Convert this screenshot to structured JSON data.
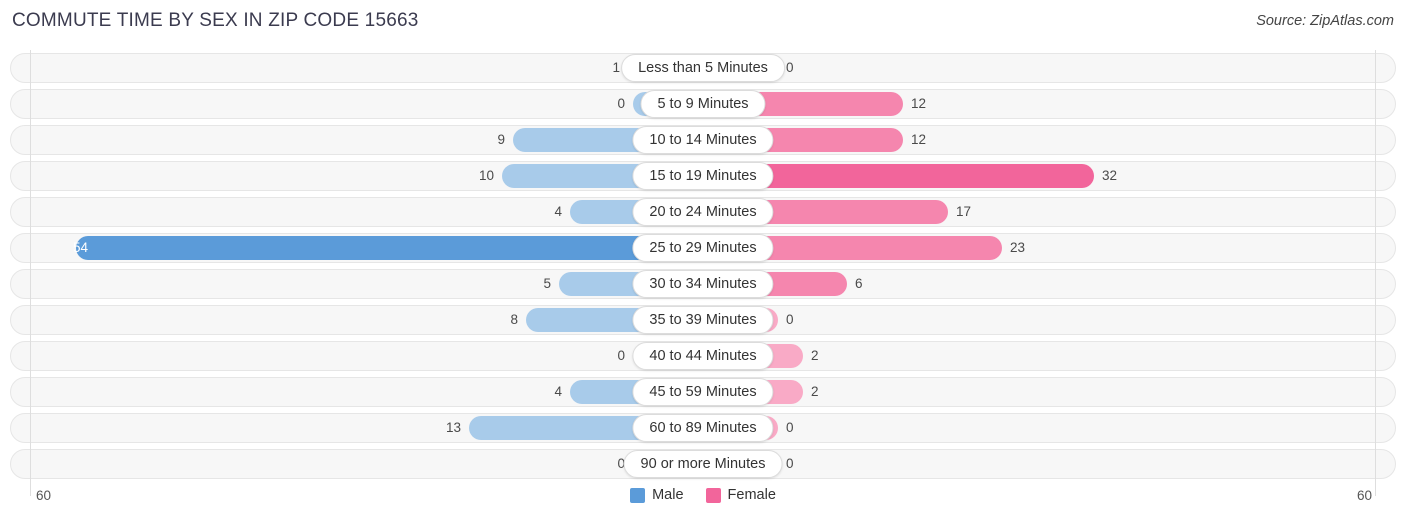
{
  "header": {
    "title": "COMMUTE TIME BY SEX IN ZIP CODE 15663",
    "source": "Source: ZipAtlas.com"
  },
  "axis": {
    "left_label": "60",
    "right_label": "60",
    "max": 60
  },
  "legend": {
    "items": [
      {
        "label": "Male",
        "color": "#5b9bd9"
      },
      {
        "label": "Female",
        "color": "#f2659b"
      }
    ]
  },
  "colors": {
    "male_light": "#a8cbea",
    "male_dark": "#5b9bd9",
    "female_light": "#f9aac6",
    "female_mid": "#f586ae",
    "female_dark": "#f2659b",
    "track": "#f7f7f7"
  },
  "chart_data": {
    "type": "bar",
    "title": "COMMUTE TIME BY SEX IN ZIP CODE 15663",
    "xlabel": "",
    "ylabel": "",
    "orientation": "horizontal-diverging",
    "xlim": [
      0,
      60
    ],
    "grid": false,
    "legend_position": "bottom-center",
    "categories": [
      "Less than 5 Minutes",
      "5 to 9 Minutes",
      "10 to 14 Minutes",
      "15 to 19 Minutes",
      "20 to 24 Minutes",
      "25 to 29 Minutes",
      "30 to 34 Minutes",
      "35 to 39 Minutes",
      "40 to 44 Minutes",
      "45 to 59 Minutes",
      "60 to 89 Minutes",
      "90 or more Minutes"
    ],
    "series": [
      {
        "name": "Male",
        "values": [
          1,
          0,
          9,
          10,
          4,
          54,
          5,
          8,
          0,
          4,
          13,
          0
        ]
      },
      {
        "name": "Female",
        "values": [
          0,
          12,
          12,
          32,
          17,
          23,
          6,
          0,
          2,
          2,
          0,
          0
        ]
      }
    ]
  },
  "rows": [
    {
      "label": "Less than 5 Minutes",
      "male": "1",
      "female": "0",
      "male_w": 75,
      "male_hi": false,
      "female_w": 75,
      "female_tone": ""
    },
    {
      "label": "5 to 9 Minutes",
      "male": "0",
      "female": "12",
      "male_w": 70,
      "male_hi": false,
      "female_w": 200,
      "female_tone": "mid"
    },
    {
      "label": "10 to 14 Minutes",
      "male": "9",
      "female": "12",
      "male_w": 190,
      "male_hi": false,
      "female_w": 200,
      "female_tone": "mid"
    },
    {
      "label": "15 to 19 Minutes",
      "male": "10",
      "female": "32",
      "male_w": 201,
      "male_hi": false,
      "female_w": 391,
      "female_tone": "hi"
    },
    {
      "label": "20 to 24 Minutes",
      "male": "4",
      "female": "17",
      "male_w": 133,
      "male_hi": false,
      "female_w": 245,
      "female_tone": "mid"
    },
    {
      "label": "25 to 29 Minutes",
      "male": "54",
      "female": "23",
      "male_w": 627,
      "male_hi": true,
      "female_w": 299,
      "female_tone": "mid"
    },
    {
      "label": "30 to 34 Minutes",
      "male": "5",
      "female": "6",
      "male_w": 144,
      "male_hi": false,
      "female_w": 144,
      "female_tone": "mid"
    },
    {
      "label": "35 to 39 Minutes",
      "male": "8",
      "female": "0",
      "male_w": 177,
      "male_hi": false,
      "female_w": 75,
      "female_tone": ""
    },
    {
      "label": "40 to 44 Minutes",
      "male": "0",
      "female": "2",
      "male_w": 70,
      "male_hi": false,
      "female_w": 100,
      "female_tone": ""
    },
    {
      "label": "45 to 59 Minutes",
      "male": "4",
      "female": "2",
      "male_w": 133,
      "male_hi": false,
      "female_w": 100,
      "female_tone": ""
    },
    {
      "label": "60 to 89 Minutes",
      "male": "13",
      "female": "0",
      "male_w": 234,
      "male_hi": false,
      "female_w": 75,
      "female_tone": ""
    },
    {
      "label": "90 or more Minutes",
      "male": "0",
      "female": "0",
      "male_w": 70,
      "male_hi": false,
      "female_w": 75,
      "female_tone": ""
    }
  ]
}
